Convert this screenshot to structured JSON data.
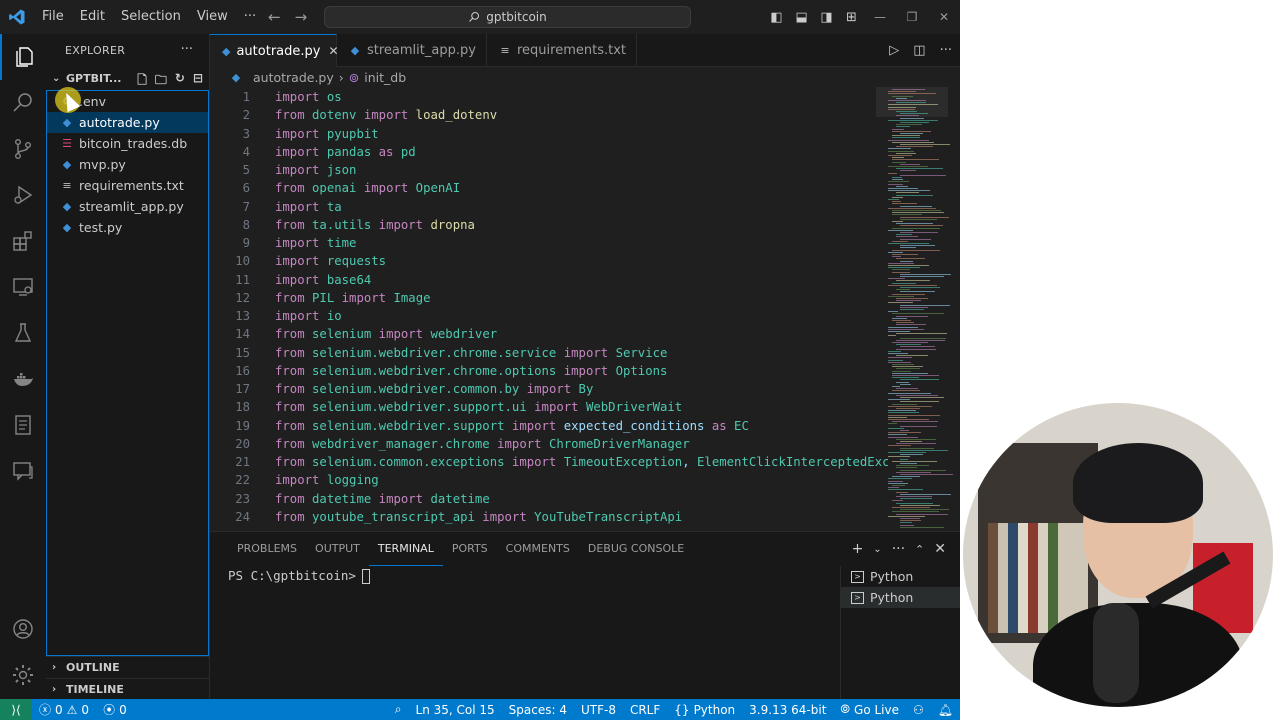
{
  "titlebar": {
    "menu": [
      "File",
      "Edit",
      "Selection",
      "View",
      "···"
    ],
    "search": "gptbitcoin"
  },
  "explorer": {
    "title": "EXPLORER",
    "folder": "GPTBIT...",
    "items": [
      {
        "name": ".env",
        "icon": "gear-icon",
        "selected": false
      },
      {
        "name": "autotrade.py",
        "icon": "python-icon",
        "selected": true
      },
      {
        "name": "bitcoin_trades.db",
        "icon": "database-icon",
        "selected": false
      },
      {
        "name": "mvp.py",
        "icon": "python-icon",
        "selected": false
      },
      {
        "name": "requirements.txt",
        "icon": "text-file-icon",
        "selected": false
      },
      {
        "name": "streamlit_app.py",
        "icon": "python-icon",
        "selected": false
      },
      {
        "name": "test.py",
        "icon": "python-icon",
        "selected": false
      }
    ],
    "outline": "OUTLINE",
    "timeline": "TIMELINE"
  },
  "tabs": [
    {
      "label": "autotrade.py",
      "active": true
    },
    {
      "label": "streamlit_app.py",
      "active": false
    },
    {
      "label": "requirements.txt",
      "active": false
    }
  ],
  "breadcrumb": {
    "file": "autotrade.py",
    "symbol": "init_db"
  },
  "code": [
    [
      [
        "kw",
        "import"
      ],
      [
        "mod",
        " os"
      ]
    ],
    [
      [
        "kw",
        "from"
      ],
      [
        "mod",
        " dotenv"
      ],
      [
        "kw",
        " import"
      ],
      [
        "id",
        " load_dotenv"
      ]
    ],
    [
      [
        "kw",
        "import"
      ],
      [
        "mod",
        " pyupbit"
      ]
    ],
    [
      [
        "kw",
        "import"
      ],
      [
        "mod",
        " pandas"
      ],
      [
        "kw",
        " as"
      ],
      [
        "mod",
        " pd"
      ]
    ],
    [
      [
        "kw",
        "import"
      ],
      [
        "mod",
        " json"
      ]
    ],
    [
      [
        "kw",
        "from"
      ],
      [
        "mod",
        " openai"
      ],
      [
        "kw",
        " import"
      ],
      [
        "mod",
        " OpenAI"
      ]
    ],
    [
      [
        "kw",
        "import"
      ],
      [
        "mod",
        " ta"
      ]
    ],
    [
      [
        "kw",
        "from"
      ],
      [
        "mod",
        " ta.utils"
      ],
      [
        "kw",
        " import"
      ],
      [
        "id",
        " dropna"
      ]
    ],
    [
      [
        "kw",
        "import"
      ],
      [
        "mod",
        " time"
      ]
    ],
    [
      [
        "kw",
        "import"
      ],
      [
        "mod",
        " requests"
      ]
    ],
    [
      [
        "kw",
        "import"
      ],
      [
        "mod",
        " base64"
      ]
    ],
    [
      [
        "kw",
        "from"
      ],
      [
        "mod",
        " PIL"
      ],
      [
        "kw",
        " import"
      ],
      [
        "mod",
        " Image"
      ]
    ],
    [
      [
        "kw",
        "import"
      ],
      [
        "mod",
        " io"
      ]
    ],
    [
      [
        "kw",
        "from"
      ],
      [
        "mod",
        " selenium"
      ],
      [
        "kw",
        " import"
      ],
      [
        "mod",
        " webdriver"
      ]
    ],
    [
      [
        "kw",
        "from"
      ],
      [
        "mod",
        " selenium.webdriver.chrome.service"
      ],
      [
        "kw",
        " import"
      ],
      [
        "mod",
        " Service"
      ]
    ],
    [
      [
        "kw",
        "from"
      ],
      [
        "mod",
        " selenium.webdriver.chrome.options"
      ],
      [
        "kw",
        " import"
      ],
      [
        "mod",
        " Options"
      ]
    ],
    [
      [
        "kw",
        "from"
      ],
      [
        "mod",
        " selenium.webdriver.common.by"
      ],
      [
        "kw",
        " import"
      ],
      [
        "mod",
        " By"
      ]
    ],
    [
      [
        "kw",
        "from"
      ],
      [
        "mod",
        " selenium.webdriver.support.ui"
      ],
      [
        "kw",
        " import"
      ],
      [
        "mod",
        " WebDriverWait"
      ]
    ],
    [
      [
        "kw",
        "from"
      ],
      [
        "mod",
        " selenium.webdriver.support"
      ],
      [
        "kw",
        " import"
      ],
      [
        "plain",
        " expected_conditions"
      ],
      [
        "kw",
        " as"
      ],
      [
        "mod",
        " EC"
      ]
    ],
    [
      [
        "kw",
        "from"
      ],
      [
        "mod",
        " webdriver_manager.chrome"
      ],
      [
        "kw",
        " import"
      ],
      [
        "mod",
        " ChromeDriverManager"
      ]
    ],
    [
      [
        "kw",
        "from"
      ],
      [
        "mod",
        " selenium.common.exceptions"
      ],
      [
        "kw",
        " import"
      ],
      [
        "mod",
        " TimeoutException"
      ],
      [
        "plain",
        ","
      ],
      [
        "mod",
        " ElementClickInterceptedExc"
      ]
    ],
    [
      [
        "kw",
        "import"
      ],
      [
        "mod",
        " logging"
      ]
    ],
    [
      [
        "kw",
        "from"
      ],
      [
        "mod",
        " datetime"
      ],
      [
        "kw",
        " import"
      ],
      [
        "mod",
        " datetime"
      ]
    ],
    [
      [
        "kw",
        "from"
      ],
      [
        "mod",
        " youtube_transcript_api"
      ],
      [
        "kw",
        " import"
      ],
      [
        "mod",
        " YouTubeTranscriptApi"
      ]
    ]
  ],
  "panel": {
    "tabs": [
      "PROBLEMS",
      "OUTPUT",
      "TERMINAL",
      "PORTS",
      "COMMENTS",
      "DEBUG CONSOLE"
    ],
    "active_tab": "TERMINAL",
    "prompt": "PS C:\\gptbitcoin>",
    "terminals": [
      "Python",
      "Python"
    ]
  },
  "status": {
    "errors": "0",
    "warnings": "0",
    "ports": "0",
    "position": "Ln 35, Col 15",
    "spaces": "Spaces: 4",
    "encoding": "UTF-8",
    "eol": "CRLF",
    "language": "Python",
    "interpreter": "3.9.13 64-bit",
    "golive": "Go Live"
  },
  "colors": {
    "accent": "#0078d4",
    "statusbar": "#007acc",
    "keyword": "#c586c0",
    "module": "#4ec9b0"
  }
}
